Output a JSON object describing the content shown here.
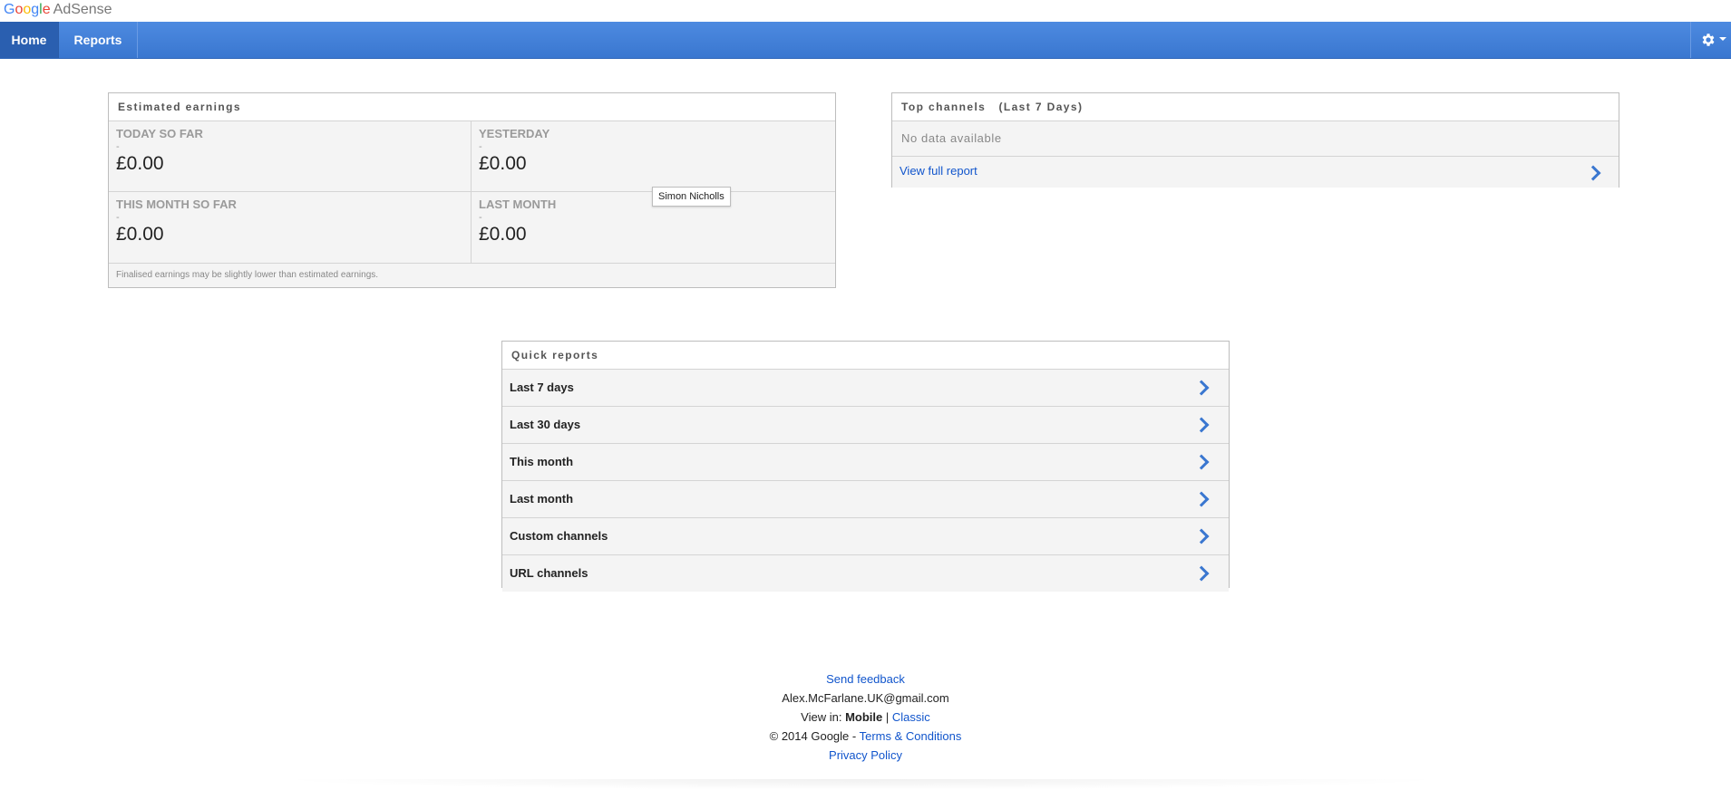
{
  "brand": {
    "google": "Google",
    "product": "AdSense"
  },
  "nav": {
    "home": "Home",
    "reports": "Reports",
    "settings_icon": "gear-icon"
  },
  "earnings": {
    "title": "Estimated earnings",
    "cells": [
      {
        "label": "TODAY SO FAR",
        "dash": "-",
        "value": "£0.00"
      },
      {
        "label": "YESTERDAY",
        "dash": "-",
        "value": "£0.00"
      },
      {
        "label": "THIS MONTH SO FAR",
        "dash": "-",
        "value": "£0.00"
      },
      {
        "label": "LAST MONTH",
        "dash": "-",
        "value": "£0.00"
      }
    ],
    "note": "Finalised earnings may be slightly lower than estimated earnings."
  },
  "tooltip": "Simon Nicholls",
  "channels": {
    "title": "Top channels   (Last 7 Days)",
    "no_data": "No data available",
    "full_report": "View full report"
  },
  "quick_reports": {
    "title": "Quick reports",
    "items": [
      "Last 7 days",
      "Last 30 days",
      "This month",
      "Last month",
      "Custom channels",
      "URL channels"
    ]
  },
  "footer": {
    "feedback": "Send feedback",
    "email": "Alex.McFarlane.UK@gmail.com",
    "view_in": "View in:",
    "mobile": "Mobile",
    "separator": "|",
    "classic": "Classic",
    "copyright": "© 2014 Google -",
    "terms": "Terms & Conditions",
    "privacy": "Privacy Policy"
  },
  "colors": {
    "nav_blue": "#3a77d0",
    "link_blue": "#1155cc"
  }
}
